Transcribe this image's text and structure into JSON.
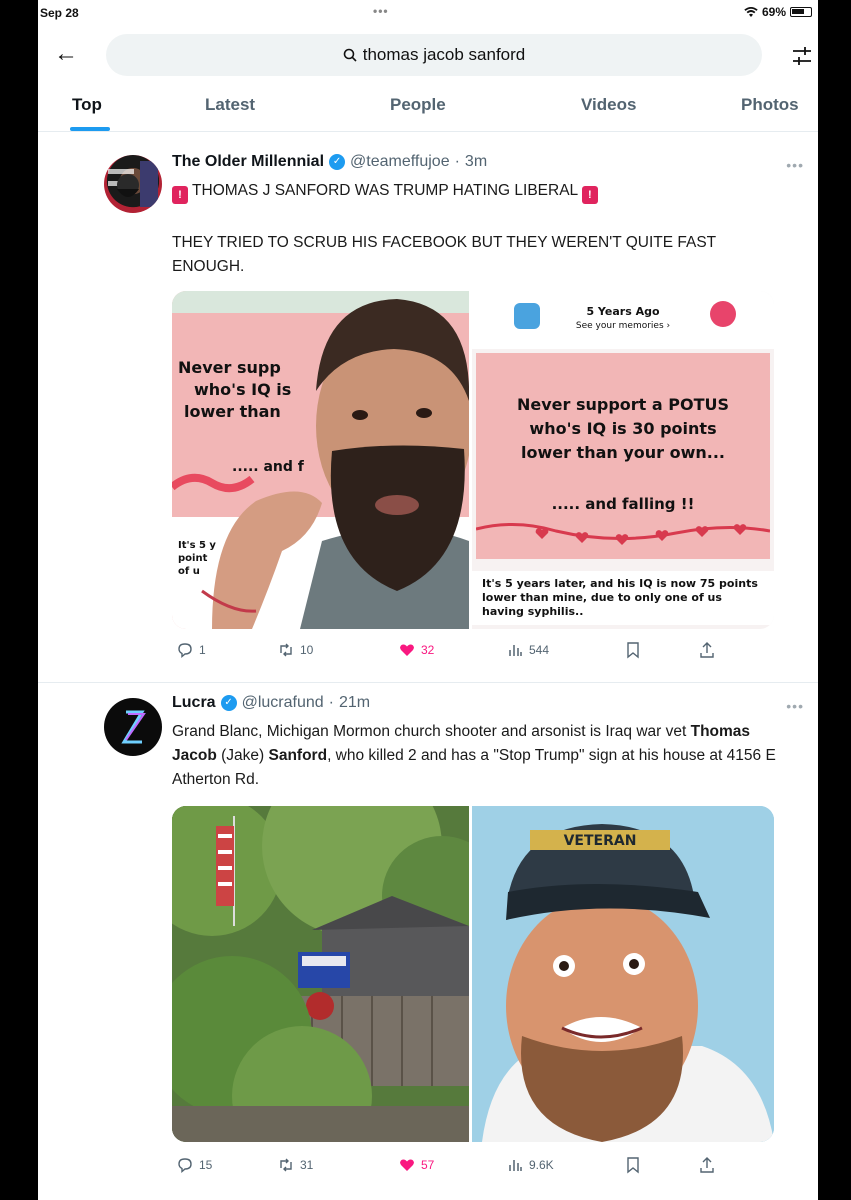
{
  "status": {
    "date": "Sep 28",
    "dots": "•••",
    "battery": "69%"
  },
  "search": {
    "query": "thomas jacob sanford"
  },
  "tabs": [
    "Top",
    "Latest",
    "People",
    "Videos",
    "Photos"
  ],
  "tweets": [
    {
      "name": "The Older Millennial",
      "handle": "@teameffujoe",
      "time": "3m",
      "headline": "THOMAS J SANFORD WAS TRUMP HATING LIBERAL",
      "body": "THEY TRIED TO SCRUB HIS FACEBOOK BUT THEY WEREN'T QUITE FAST ENOUGH.",
      "meme_left": {
        "top": "See your memories",
        "line1": "Never supp",
        "line2": "who's IQ is",
        "line3": "lower than",
        "falling": "..... and f",
        "foot1": "It's 5 y",
        "foot2": "point",
        "foot3": "of u"
      },
      "meme_right": {
        "header_title": "5 Years Ago",
        "header_sub": "See your memories ›",
        "line1": "Never support a POTUS",
        "line2": "who's IQ is 30 points",
        "line3": "lower than your own...",
        "falling": "..... and falling !!",
        "foot": "It's 5 years later, and his IQ is now 75 points lower than mine, due to only one of us having syphilis.."
      },
      "stats": {
        "replies": "1",
        "reposts": "10",
        "likes": "32",
        "views": "544"
      }
    },
    {
      "name": "Lucra",
      "handle": "@lucrafund",
      "time": "21m",
      "body_part1": "Grand Blanc, Michigan Mormon church shooter and arsonist is Iraq war vet ",
      "body_bold1": "Thomas Jacob",
      "body_part2": " (Jake) ",
      "body_bold2": "Sanford",
      "body_part3": ", who killed 2 and has a \"Stop Trump\" sign at his house at 4156 E Atherton Rd.",
      "cap_text": "VETERAN",
      "stats": {
        "replies": "15",
        "reposts": "31",
        "likes": "57",
        "views": "9.6K"
      }
    }
  ],
  "colors": {
    "accent": "#1d9bf0",
    "like": "#f91880",
    "meme_pink": "#f2b6b6"
  }
}
